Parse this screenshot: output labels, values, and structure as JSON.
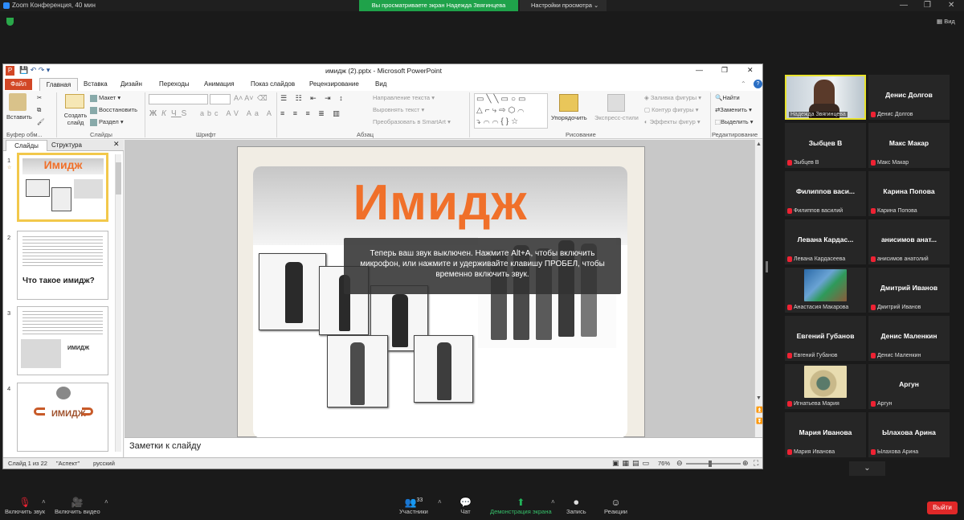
{
  "zoom": {
    "window_title": "Zoom Конференция, 40 мин",
    "share_banner": "Вы просматриваете экран Надежда Звягинцева",
    "view_options": "Настройки просмотра",
    "view_button": "Вид",
    "accent": "#1fa24a"
  },
  "ppt": {
    "title": "имидж (2).pptx - Microsoft PowerPoint",
    "tabs": [
      "Файл",
      "Главная",
      "Вставка",
      "Дизайн",
      "Переходы",
      "Анимация",
      "Показ слайдов",
      "Рецензирование",
      "Вид"
    ],
    "ribbon": {
      "paste": "Вставить",
      "clipboard": "Буфер обм...",
      "create_slide": "Создать слайд",
      "layout": "Макет",
      "reset": "Восстановить",
      "section": "Раздел",
      "slides_group": "Слайды",
      "font_group": "Шрифт",
      "paragraph_group": "Абзац",
      "text_direction": "Направление текста",
      "align_text": "Выровнять текст",
      "smartart": "Преобразовать в SmartArt",
      "arrange": "Упорядочить",
      "quick_styles": "Экспресс-стили",
      "drawing_group": "Рисование",
      "shape_fill": "Заливка фигуры",
      "shape_outline": "Контур фигуры",
      "shape_effects": "Эффекты фигур",
      "find": "Найти",
      "replace": "Заменить",
      "select": "Выделить",
      "editing_group": "Редактирование"
    },
    "pane_tabs": [
      "Слайды",
      "Структура"
    ],
    "thumbs": [
      {
        "num": "1",
        "title": "Имидж"
      },
      {
        "num": "2",
        "title": "Что такое имидж?"
      },
      {
        "num": "3",
        "title": "ИМИДЖ"
      },
      {
        "num": "4",
        "title": "ИМИДЖ"
      }
    ],
    "slide_title": "Имидж",
    "notes_placeholder": "Заметки к слайду",
    "status": {
      "slide": "Слайд 1 из 22",
      "theme": "\"Аспект\"",
      "lang": "русский",
      "zoom": "76%"
    }
  },
  "overlay_text": "Теперь ваш звук выключен. Нажмите Alt+A, чтобы включить микрофон, или нажмите и удерживайте клавишу ПРОБЕЛ, чтобы временно включить звук.",
  "participants": [
    {
      "name": "",
      "label": "Надежда Звягинцева",
      "has_video": true,
      "highlight": true
    },
    {
      "name": "Денис Долгов",
      "label": "Денис Долгов"
    },
    {
      "name": "Зыбцев В",
      "label": "Зыбцев В"
    },
    {
      "name": "Макс Макар",
      "label": "Макс Макар"
    },
    {
      "name": "Филиппов васи...",
      "label": "Филиппов василий"
    },
    {
      "name": "Карина Попова",
      "label": "Карина Попова"
    },
    {
      "name": "Левана Кардас...",
      "label": "Левана Кардасеева"
    },
    {
      "name": "анисимов анат...",
      "label": "анисимов анатолий"
    },
    {
      "name": "",
      "label": "Анастасия Макарова",
      "has_photo": true
    },
    {
      "name": "Дмитрий Иванов",
      "label": "Дмитрий Иванов"
    },
    {
      "name": "Евгений Губанов",
      "label": "Евгений Губанов"
    },
    {
      "name": "Денис Маленкин",
      "label": "Денис Маленкин"
    },
    {
      "name": "",
      "label": "Игнатьева Мария",
      "has_photo": true
    },
    {
      "name": "Аргун",
      "label": "Аргун"
    },
    {
      "name": "Мария Иванова",
      "label": "Мария Иванова"
    },
    {
      "name": "Ылахова Арина",
      "label": "Ылахова Арина"
    }
  ],
  "toolbar": {
    "audio": "Включить звук",
    "video": "Включить видео",
    "participants": "Участники",
    "participants_count": "33",
    "chat": "Чат",
    "share": "Демонстрация экрана",
    "record": "Запись",
    "reactions": "Реакции",
    "leave": "Выйти"
  }
}
